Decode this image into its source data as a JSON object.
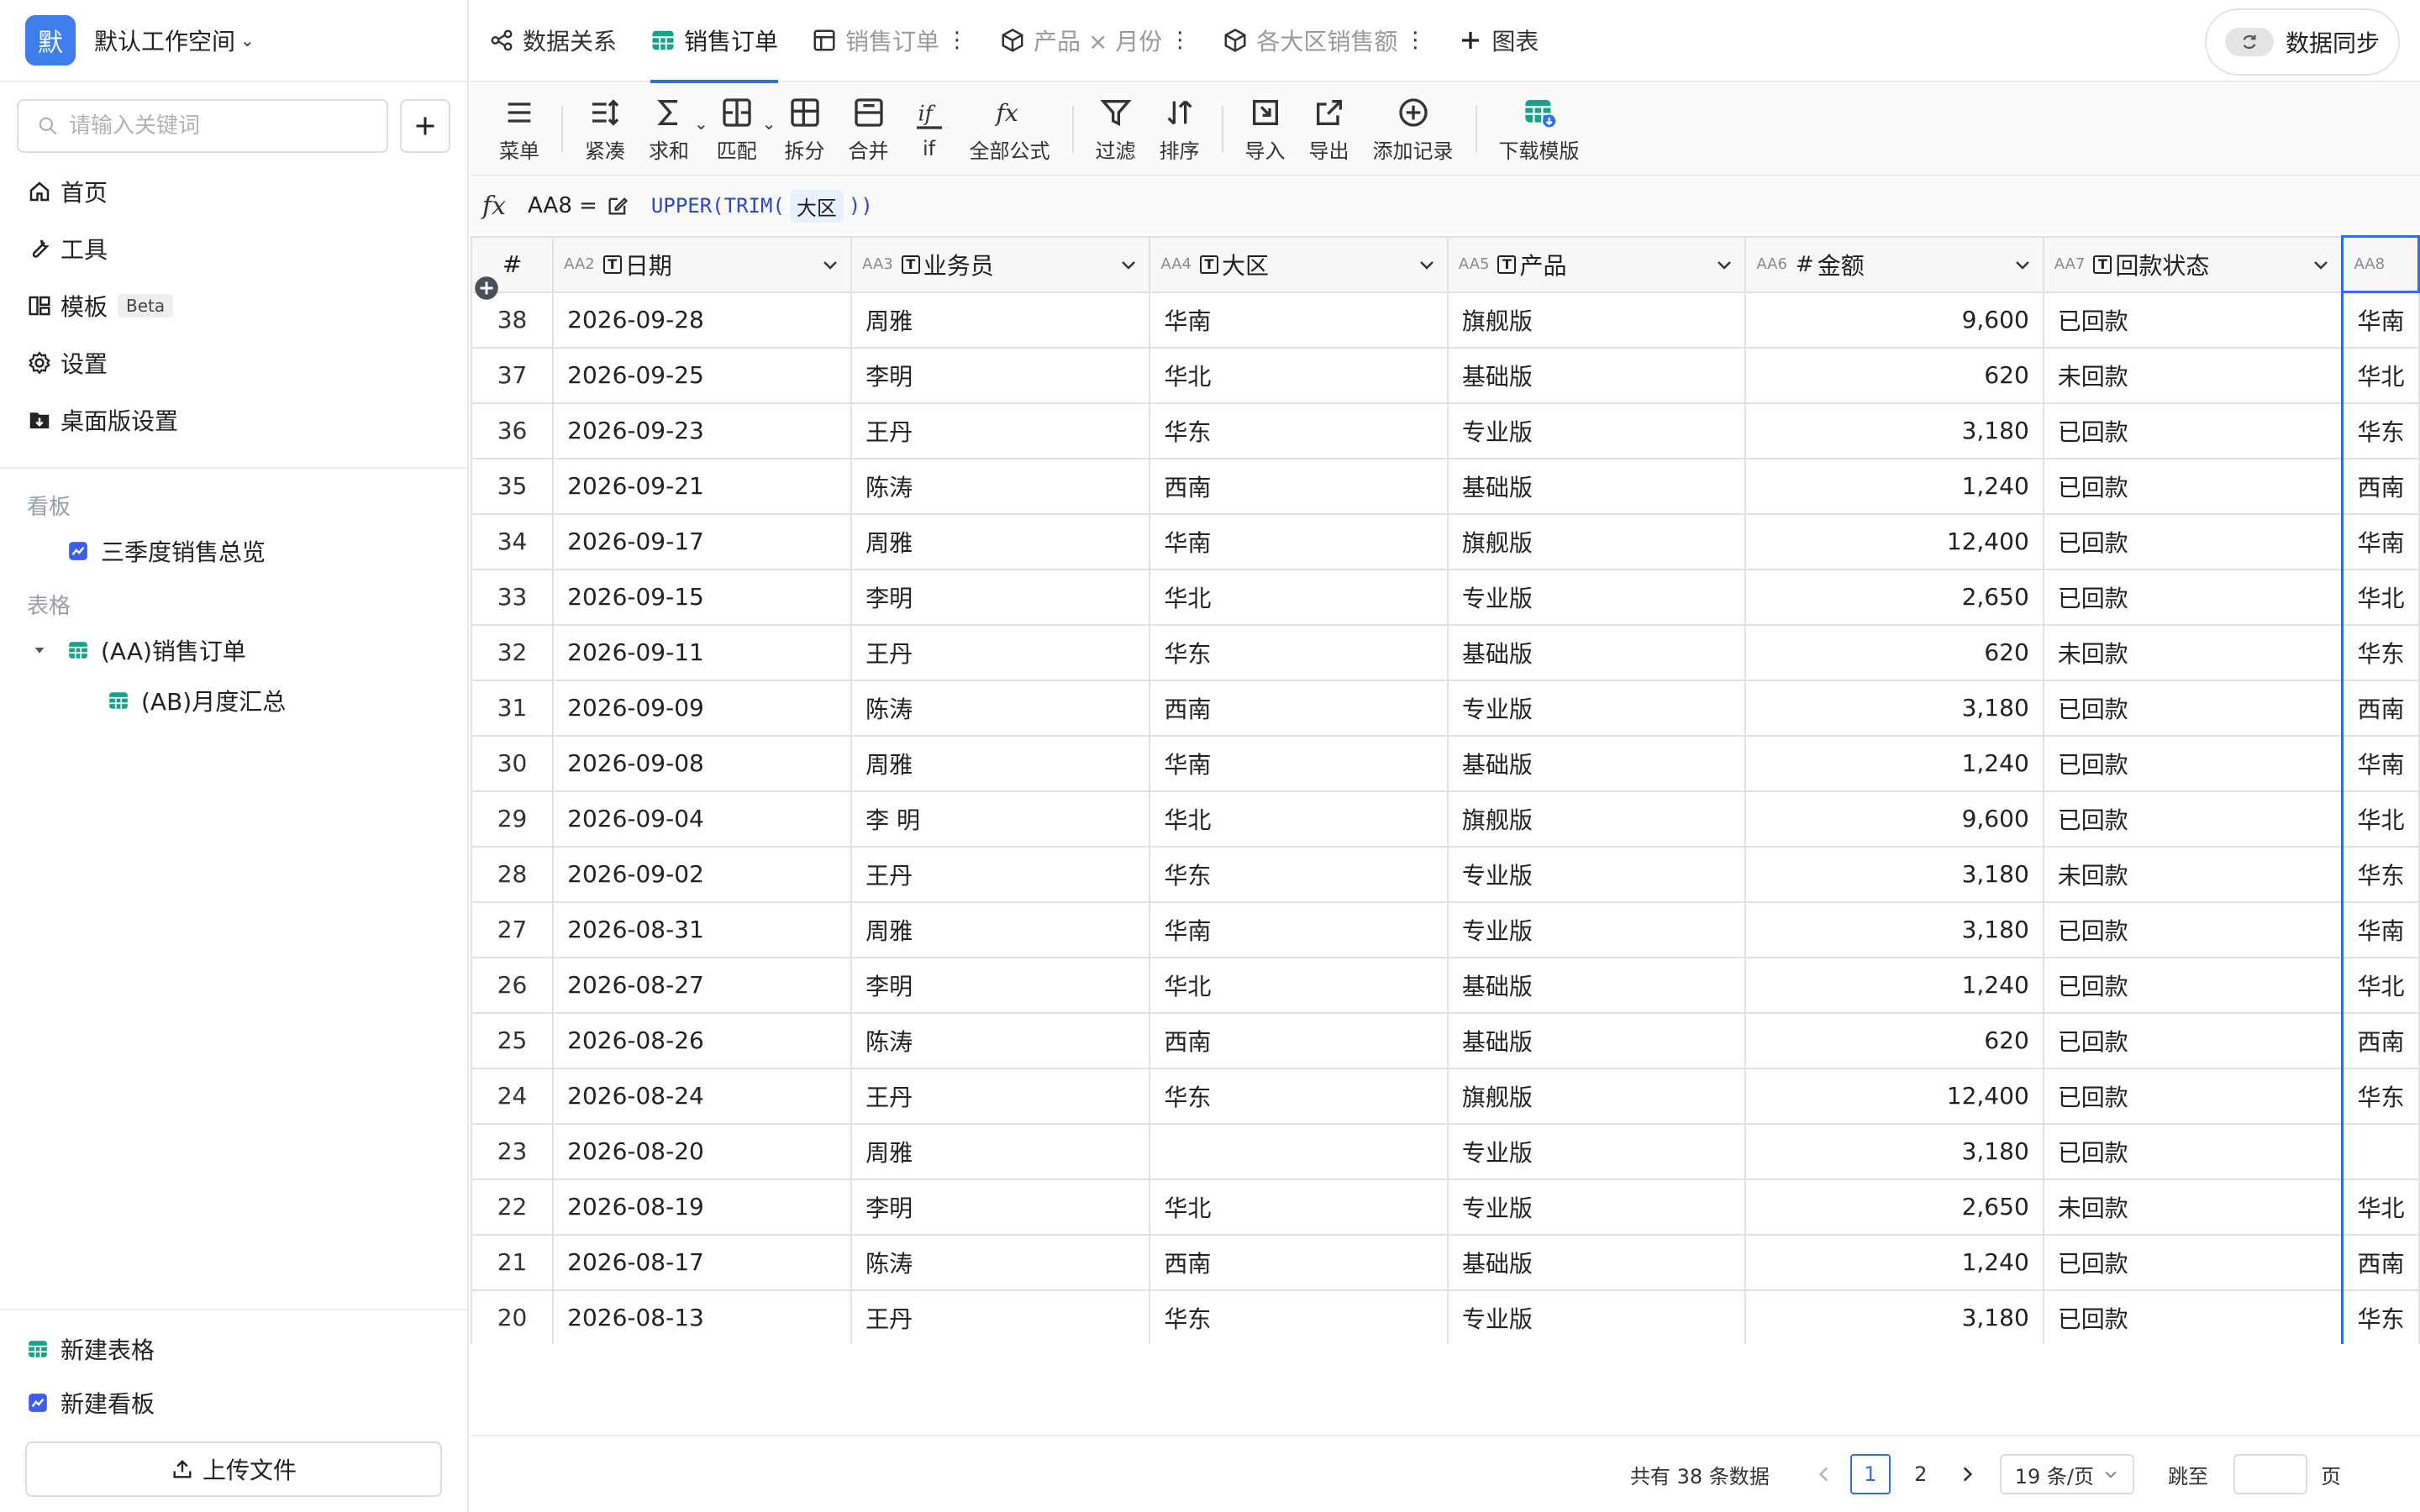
{
  "workspace": {
    "avatar": "默",
    "name": "默认工作空间"
  },
  "search": {
    "placeholder": "请输入关键词"
  },
  "nav": {
    "home": "首页",
    "tools": "工具",
    "templates": "模板",
    "beta": "Beta",
    "settings": "设置",
    "desktop": "桌面版设置"
  },
  "sections": {
    "boards": "看板",
    "board_item": "三季度销售总览",
    "tables": "表格",
    "table_aa": "(AA)销售订单",
    "table_ab": "(AB)月度汇总"
  },
  "bottom": {
    "new_table": "新建表格",
    "new_board": "新建看板",
    "upload": "上传文件"
  },
  "tabs": {
    "relations": "数据关系",
    "orders": "销售订单",
    "orders_view": "销售订单",
    "pivot": "产品 × 月份",
    "region_sales": "各大区销售额",
    "chart": "图表",
    "sync": "数据同步"
  },
  "toolbar": {
    "menu": "菜单",
    "compact": "紧凑",
    "sum": "求和",
    "match": "匹配",
    "split": "拆分",
    "merge": "合并",
    "if": "if",
    "formulas": "全部公式",
    "filter": "过滤",
    "sort": "排序",
    "import": "导入",
    "export": "导出",
    "add_record": "添加记录",
    "download_template": "下载模版"
  },
  "formula": {
    "fx": "fx",
    "cell": "AA8 =",
    "func_open": "UPPER(TRIM(",
    "field": "大区",
    "func_close": "))"
  },
  "columns": {
    "rownum": "#",
    "c1_id": "AA2",
    "c1": "日期",
    "c2_id": "AA3",
    "c2": "业务员",
    "c3_id": "AA4",
    "c3": "大区",
    "c4_id": "AA5",
    "c4": "产品",
    "c5_id": "AA6",
    "c5": "金额",
    "c6_id": "AA7",
    "c6": "回款状态",
    "c7_id": "AA8"
  },
  "rows": [
    {
      "n": "38",
      "date": "2026-09-28",
      "rep": "周雅",
      "region": "华南",
      "product": "旗舰版",
      "amount": "9,600",
      "status": "已回款",
      "calc": "华南"
    },
    {
      "n": "37",
      "date": "2026-09-25",
      "rep": "李明",
      "region": "华北",
      "product": "基础版",
      "amount": "620",
      "status": "未回款",
      "calc": "华北"
    },
    {
      "n": "36",
      "date": "2026-09-23",
      "rep": "王丹",
      "region": "华东",
      "product": "专业版",
      "amount": "3,180",
      "status": "已回款",
      "calc": "华东"
    },
    {
      "n": "35",
      "date": "2026-09-21",
      "rep": "陈涛",
      "region": "西南",
      "product": "基础版",
      "amount": "1,240",
      "status": "已回款",
      "calc": "西南"
    },
    {
      "n": "34",
      "date": "2026-09-17",
      "rep": "周雅",
      "region": "华南",
      "product": "旗舰版",
      "amount": "12,400",
      "status": "已回款",
      "calc": "华南"
    },
    {
      "n": "33",
      "date": "2026-09-15",
      "rep": "李明",
      "region": "华北",
      "product": "专业版",
      "amount": "2,650",
      "status": "已回款",
      "calc": "华北"
    },
    {
      "n": "32",
      "date": "2026-09-11",
      "rep": "王丹",
      "region": "华东",
      "product": "基础版",
      "amount": "620",
      "status": "未回款",
      "calc": "华东"
    },
    {
      "n": "31",
      "date": "2026-09-09",
      "rep": "陈涛",
      "region": "西南",
      "product": "专业版",
      "amount": "3,180",
      "status": "已回款",
      "calc": "西南"
    },
    {
      "n": "30",
      "date": "2026-09-08",
      "rep": "周雅",
      "region": "华南",
      "product": "基础版",
      "amount": "1,240",
      "status": "已回款",
      "calc": "华南"
    },
    {
      "n": "29",
      "date": "2026-09-04",
      "rep": "李 明",
      "region": "华北",
      "product": "旗舰版",
      "amount": "9,600",
      "status": "已回款",
      "calc": "华北"
    },
    {
      "n": "28",
      "date": "2026-09-02",
      "rep": "王丹",
      "region": "华东",
      "product": "专业版",
      "amount": "3,180",
      "status": "未回款",
      "calc": "华东"
    },
    {
      "n": "27",
      "date": "2026-08-31",
      "rep": "周雅",
      "region": "华南",
      "product": "专业版",
      "amount": "3,180",
      "status": "已回款",
      "calc": "华南"
    },
    {
      "n": "26",
      "date": "2026-08-27",
      "rep": "李明",
      "region": "华北",
      "product": "基础版",
      "amount": "1,240",
      "status": "已回款",
      "calc": "华北"
    },
    {
      "n": "25",
      "date": "2026-08-26",
      "rep": "陈涛",
      "region": "西南",
      "product": "基础版",
      "amount": "620",
      "status": "已回款",
      "calc": "西南"
    },
    {
      "n": "24",
      "date": "2026-08-24",
      "rep": "王丹",
      "region": "华东",
      "product": "旗舰版",
      "amount": "12,400",
      "status": "已回款",
      "calc": "华东"
    },
    {
      "n": "23",
      "date": "2026-08-20",
      "rep": "周雅",
      "region": "",
      "product": "专业版",
      "amount": "3,180",
      "status": "已回款",
      "calc": ""
    },
    {
      "n": "22",
      "date": "2026-08-19",
      "rep": "李明",
      "region": "华北",
      "product": "专业版",
      "amount": "2,650",
      "status": "未回款",
      "calc": "华北"
    },
    {
      "n": "21",
      "date": "2026-08-17",
      "rep": "陈涛",
      "region": "西南",
      "product": "基础版",
      "amount": "1,240",
      "status": "已回款",
      "calc": "西南"
    },
    {
      "n": "20",
      "date": "2026-08-13",
      "rep": "王丹",
      "region": "华东",
      "product": "专业版",
      "amount": "3,180",
      "status": "已回款",
      "calc": "华东"
    }
  ],
  "pager": {
    "total": "共有 38 条数据",
    "page1": "1",
    "page2": "2",
    "page_size": "19 条/页",
    "jump": "跳至",
    "page_unit": "页"
  },
  "colors": {
    "accent": "#2f6fed",
    "avatar": "#3d7eea",
    "table_icon": "#17a28a",
    "board_icon": "#3d5cf0"
  }
}
